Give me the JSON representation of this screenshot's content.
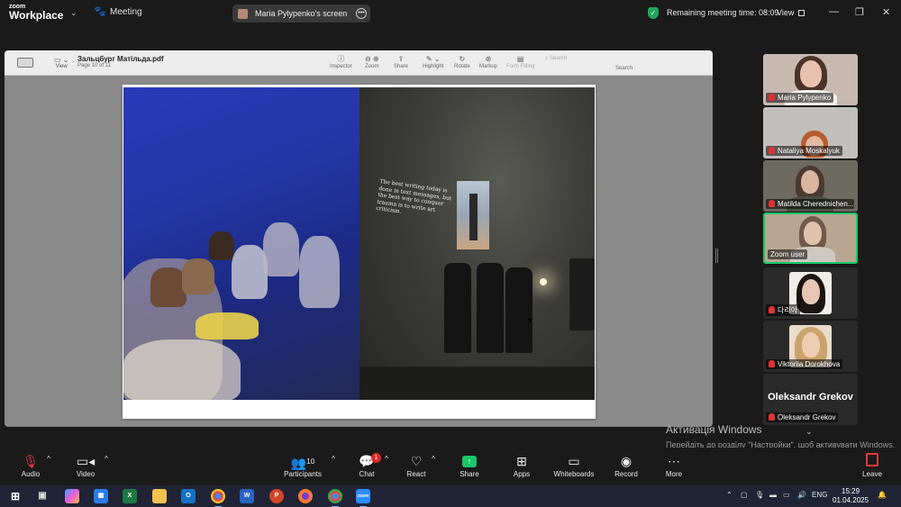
{
  "app": {
    "brand_line1": "zoom",
    "brand_line2": "Workplace",
    "meeting_label": "Meeting",
    "screen_share_label": "Maria Pylypenko's screen",
    "remaining_time": "Remaining meeting time: 08:09",
    "view_label": "View",
    "colors": {
      "accent_green": "#19c76a",
      "muted_red": "#e03b3b",
      "share_green": "#19c76a"
    }
  },
  "shared_app": {
    "view_label": "View",
    "doc_title": "Зальцбург Матільда.pdf",
    "page_info": "Page 10 of 11",
    "tools": [
      "Inspector",
      "Zoom",
      "Share",
      "Highlight",
      "Rotate",
      "Markup",
      "Form Filling"
    ],
    "search_placeholder": "Search",
    "search_label": "Search",
    "projected_text": "The best writing today is done in text messages, but the best way to conquer trauma is to write art criticism."
  },
  "participants": [
    {
      "name": "Maria Pylypenko",
      "muted": true
    },
    {
      "name": "Nataliya Moskalyuk",
      "muted": true
    },
    {
      "name": "Matilda Cherednichen...",
      "muted": true
    },
    {
      "name": "Zoom user",
      "muted": false,
      "active_speaker": true
    },
    {
      "name": "다리아",
      "muted": true
    },
    {
      "name": "Viktoriia Dorokhova",
      "muted": true
    },
    {
      "name": "Oleksandr Grekov",
      "muted": true,
      "display_name_large": "Oleksandr Grekov"
    }
  ],
  "windows_watermark": {
    "title": "Активація Windows",
    "subtitle": "Перейдіть до розділу \"Настройки\", щоб активувати Windows."
  },
  "toolbar": {
    "audio": "Audio",
    "video": "Video",
    "participants": "Participants",
    "participants_count": "10",
    "chat": "Chat",
    "chat_badge": "1",
    "react": "React",
    "share": "Share",
    "apps": "Apps",
    "whiteboards": "Whiteboards",
    "record": "Record",
    "more": "More",
    "leave": "Leave"
  },
  "taskbar": {
    "language": "ENG",
    "time": "15:29",
    "date": "01.04.2025",
    "apps": [
      "start-icon",
      "task-view-icon",
      "copilot-icon",
      "store-icon",
      "excel-icon",
      "file-explorer-icon",
      "outlook-icon",
      "chrome-icon",
      "word-icon",
      "powerpoint-icon",
      "firefox-icon",
      "chrome-profile-icon",
      "zoom-icon"
    ]
  }
}
